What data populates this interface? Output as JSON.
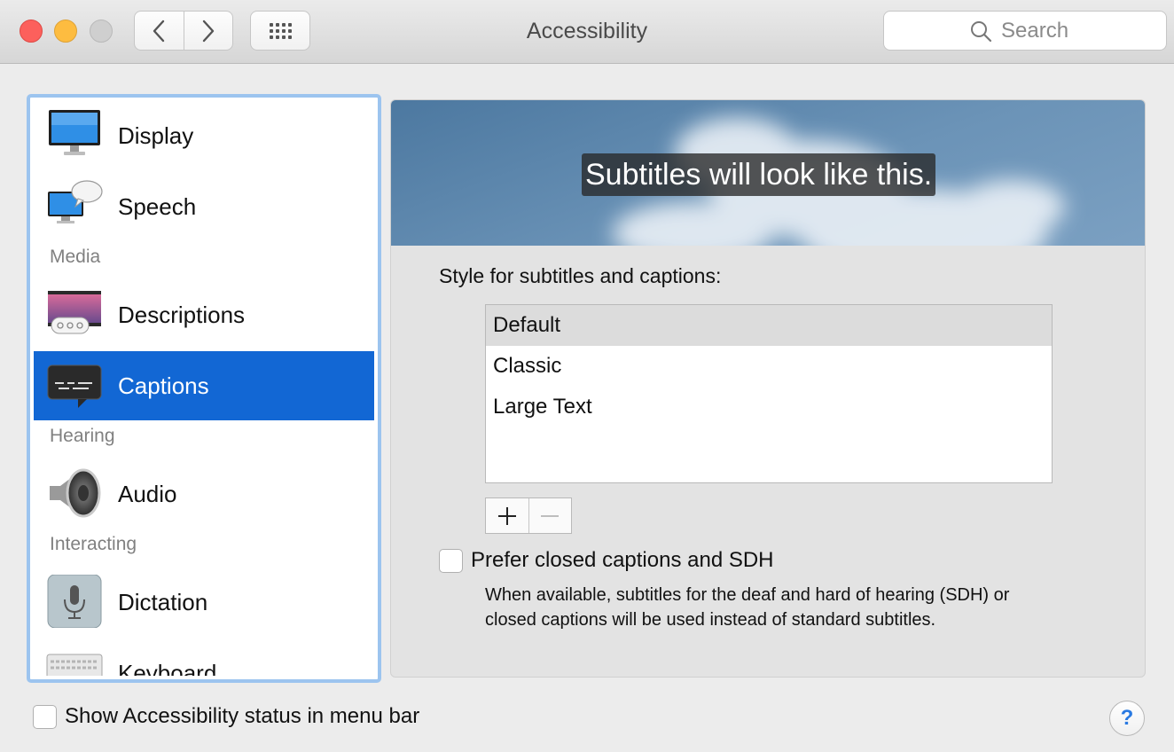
{
  "window": {
    "title": "Accessibility"
  },
  "toolbar": {
    "back_icon": "chevron-left-icon",
    "forward_icon": "chevron-right-icon",
    "grid_icon": "grid-icon",
    "search_placeholder": "Search"
  },
  "sidebar": {
    "items": [
      {
        "label": "Display",
        "icon": "display-icon"
      },
      {
        "label": "Speech",
        "icon": "speech-icon"
      },
      {
        "section": "Media"
      },
      {
        "label": "Descriptions",
        "icon": "descriptions-icon"
      },
      {
        "label": "Captions",
        "icon": "captions-icon",
        "selected": true
      },
      {
        "section": "Hearing"
      },
      {
        "label": "Audio",
        "icon": "speaker-icon"
      },
      {
        "section": "Interacting"
      },
      {
        "label": "Dictation",
        "icon": "microphone-icon"
      },
      {
        "label": "Keyboard",
        "icon": "keyboard-icon"
      }
    ]
  },
  "captions": {
    "preview_text": "Subtitles will look like this.",
    "style_label": "Style for subtitles and captions:",
    "styles": [
      "Default",
      "Classic",
      "Large Text"
    ],
    "selected_style": "Default",
    "prefer_label": "Prefer closed captions and SDH",
    "prefer_checked": false,
    "prefer_description": "When available, subtitles for the deaf and hard of hearing (SDH) or closed captions will be used instead of standard subtitles."
  },
  "footer": {
    "status_label": "Show Accessibility status in menu bar",
    "status_checked": false,
    "help_label": "?"
  },
  "colors": {
    "selection": "#1267d4",
    "focus_ring": "#9cc4ef",
    "close": "#fc605c",
    "minimize": "#fdbc40"
  }
}
